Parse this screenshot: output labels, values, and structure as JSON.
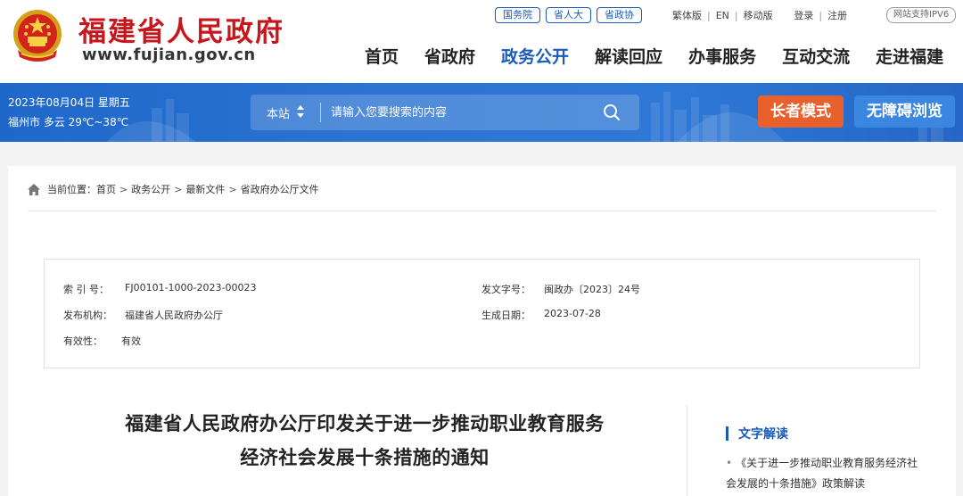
{
  "header": {
    "site_name": "福建省人民政府",
    "site_url": "www.fujian.gov.cn",
    "quick_links": [
      "国务院",
      "省人大",
      "省政协"
    ],
    "util_links": [
      "繁体版",
      "EN",
      "移动版"
    ],
    "account_links": [
      "登录",
      "注册"
    ],
    "ipv6_badge": "网站支持IPV6",
    "nav": [
      "首页",
      "省政府",
      "政务公开",
      "解读回应",
      "办事服务",
      "互动交流",
      "走进福建"
    ],
    "nav_active": "政务公开"
  },
  "band": {
    "date": "2023年08月04日 星期五",
    "weather": "福州市 多云 29℃~38℃",
    "search_scope": "本站",
    "search_placeholder": "请输入您要搜索的内容",
    "elder_mode_label": "长者模式",
    "accessible_label": "无障碍浏览"
  },
  "breadcrumb": {
    "label": "当前位置：",
    "items": [
      "首页",
      "政务公开",
      "最新文件",
      "省政府办公厅文件"
    ]
  },
  "meta": {
    "index_no_label": "索 引 号：",
    "index_no": "FJ00101-1000-2023-00023",
    "doc_no_label": "发文字号：",
    "doc_no": "闽政办〔2023〕24号",
    "issuer_label": "发布机构：",
    "issuer": "福建省人民政府办公厅",
    "date_label": "生成日期：",
    "date": "2023-07-28",
    "validity_label": "有效性：",
    "validity": "有效"
  },
  "article": {
    "title_line1": "福建省人民政府办公厅印发关于进一步推动职业教育服务",
    "title_line2": "经济社会发展十条措施的通知"
  },
  "sidebar": {
    "title": "文字解读",
    "link": "《关于进一步推动职业教育服务经济社会发展的十条措施》政策解读"
  },
  "colors": {
    "brand_red": "#c8161d",
    "nav_blue": "#1a5bb8",
    "band_blue": "#2c74d2",
    "elder_orange": "#e8602c",
    "access_blue": "#3b87e0"
  }
}
